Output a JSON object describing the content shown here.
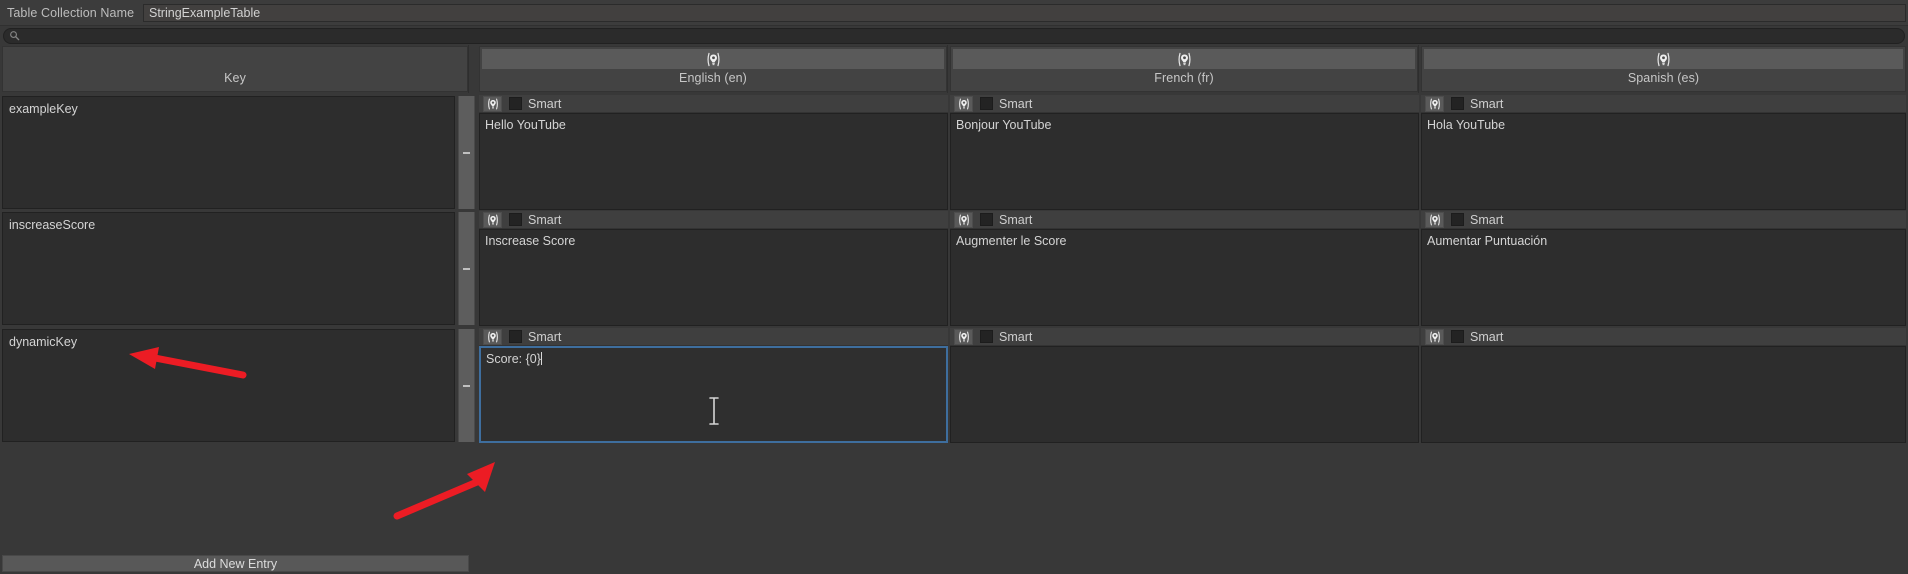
{
  "window": {
    "title": "Localization Tables",
    "accent_focus_color": "#3e6e9e",
    "background_color": "#383838"
  },
  "toolbar": {
    "collection_name_label": "Table Collection Name",
    "collection_name_value": "StringExampleTable"
  },
  "search": {
    "icon": "search-icon",
    "value": "",
    "placeholder": ""
  },
  "columns": [
    {
      "id": "key",
      "title": "Key",
      "icon": null
    },
    {
      "id": "en",
      "title": "English (en)",
      "icon": "locale-smart-icon"
    },
    {
      "id": "fr",
      "title": "French (fr)",
      "icon": "locale-smart-icon"
    },
    {
      "id": "es",
      "title": "Spanish (es)",
      "icon": "locale-smart-icon"
    }
  ],
  "smart": {
    "label": "Smart",
    "icon": "locale-smart-icon",
    "checkbox_state": "unchecked"
  },
  "rows": [
    {
      "key": "exampleKey",
      "cells": [
        {
          "locale": "en",
          "value": "Hello YouTube",
          "smart": false,
          "focused": false
        },
        {
          "locale": "fr",
          "value": "Bonjour YouTube",
          "smart": false,
          "focused": false
        },
        {
          "locale": "es",
          "value": "Hola YouTube",
          "smart": false,
          "focused": false
        }
      ]
    },
    {
      "key": "inscreaseScore",
      "cells": [
        {
          "locale": "en",
          "value": "Inscrease Score",
          "smart": false,
          "focused": false
        },
        {
          "locale": "fr",
          "value": "Augmenter le Score",
          "smart": false,
          "focused": false
        },
        {
          "locale": "es",
          "value": "Aumentar Puntuación",
          "smart": false,
          "focused": false
        }
      ]
    },
    {
      "key": "dynamicKey",
      "cells": [
        {
          "locale": "en",
          "value": "Score: {0}",
          "smart": false,
          "focused": true
        },
        {
          "locale": "fr",
          "value": "",
          "smart": false,
          "focused": false
        },
        {
          "locale": "es",
          "value": "",
          "smart": false,
          "focused": false
        }
      ]
    }
  ],
  "add_new_entry": {
    "label": "Add New Entry"
  },
  "annotations": {
    "arrow_color": "#ec1c24",
    "arrow_1_target": "dynamicKey row key cell",
    "arrow_2_target": "English value field for dynamicKey"
  }
}
